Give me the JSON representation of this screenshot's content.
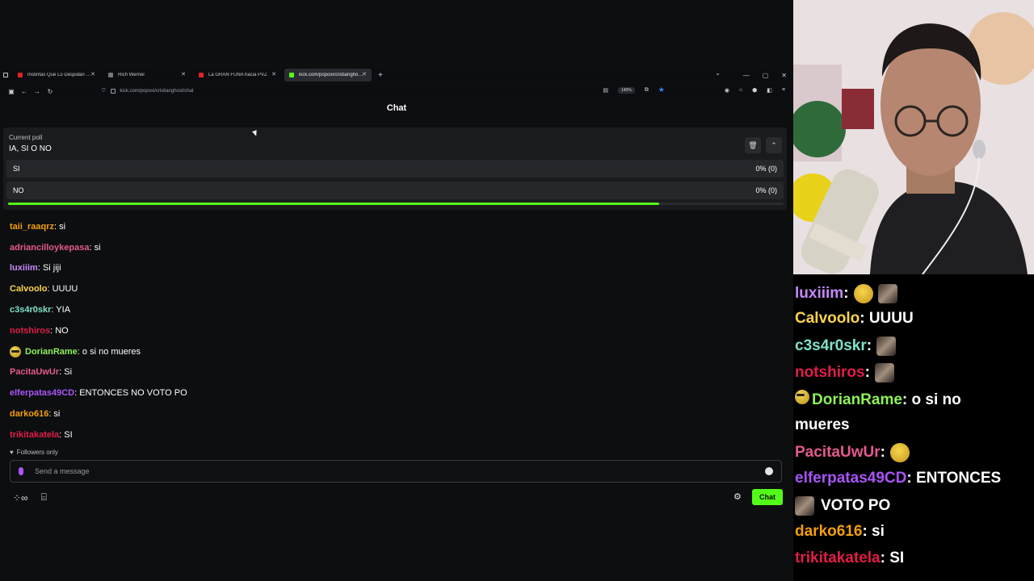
{
  "browser": {
    "tabs": [
      {
        "label": "Instintas Que Lo Despidan - Yo",
        "favicon_color": "#e02424",
        "active": false
      },
      {
        "label": "Rich Werner",
        "favicon_color": "#777777",
        "active": false
      },
      {
        "label": "La GRAN FUNA hacia PVZ",
        "favicon_color": "#e02424",
        "active": false
      },
      {
        "label": "kick.com/popoxi/cristianghost/chat",
        "favicon_color": "#53fc18",
        "active": true
      }
    ],
    "url": "kick.com/popoxi/cristianghost/chat",
    "zoom": "140%"
  },
  "page": {
    "title": "Chat"
  },
  "poll": {
    "caption": "Current poll",
    "question": "IA, SI O NO",
    "options": [
      {
        "label": "SI",
        "result": "0% (0)"
      },
      {
        "label": "NO",
        "result": "0% (0)"
      }
    ],
    "time_remaining_fraction": 0.84
  },
  "chat": {
    "messages": [
      {
        "user": "taii_raaqrz",
        "color": "#f59e0b",
        "text": ": si",
        "emote": false
      },
      {
        "user": "adriancilloykepasa",
        "color": "#e45a8c",
        "text": ": si",
        "emote": false
      },
      {
        "user": "luxiiim",
        "color": "#c58af9",
        "text": ": Si jiji",
        "emote": false
      },
      {
        "user": "Calvoolo",
        "color": "#fcd34d",
        "text": ": UUUU",
        "emote": false
      },
      {
        "user": "c3s4r0skr",
        "color": "#7ee2c8",
        "text": ": YIA",
        "emote": false
      },
      {
        "user": "notshiros",
        "color": "#e11d48",
        "text": ": NO",
        "emote": false
      },
      {
        "user": "DorianRame",
        "color": "#8ef25a",
        "text": ": o si no mueres",
        "emote": true
      },
      {
        "user": "PacitaUwUr",
        "color": "#e45a8c",
        "text": ": Si",
        "emote": false
      },
      {
        "user": "elferpatas49CD",
        "color": "#a855f7",
        "text": ": ENTONCES NO VOTO PO",
        "emote": false
      },
      {
        "user": "darko616",
        "color": "#f59e0b",
        "text": ": si",
        "emote": false
      },
      {
        "user": "trikitakatela",
        "color": "#e11d48",
        "text": ": SI",
        "emote": false
      }
    ],
    "followers_label": "Followers only",
    "input_placeholder": "Send a message",
    "send_label": "Chat"
  },
  "overlay": {
    "lines": [
      {
        "user": "luxiiim",
        "color": "#c58af9",
        "text": ":",
        "emotes": [
          "thumb",
          "photo"
        ]
      },
      {
        "user": "Calvoolo",
        "color": "#fcd34d",
        "text": ": UUUU",
        "emotes": []
      },
      {
        "user": "c3s4r0skr",
        "color": "#7ee2c8",
        "text": ":",
        "emotes": [
          "photo"
        ]
      },
      {
        "user": "notshiros",
        "color": "#e11d48",
        "text": ":",
        "emotes": [
          "photo"
        ]
      },
      {
        "user": "DorianRame",
        "color": "#8ef25a",
        "text": ": o si no",
        "emotes": [],
        "badge": true
      },
      {
        "user": "",
        "color": "#ffffff",
        "text": "mueres",
        "emotes": []
      },
      {
        "user": "PacitaUwUr",
        "color": "#e45a8c",
        "text": ":",
        "emotes": [
          "thumb"
        ]
      },
      {
        "user": "elferpatas49CD",
        "color": "#a855f7",
        "text": ": ENTONCES",
        "emotes": []
      },
      {
        "user": "",
        "color": "#ffffff",
        "text": "VOTO PO",
        "emotes": [],
        "lead_photo": true
      },
      {
        "user": "darko616",
        "color": "#f59e0b",
        "text": ": si",
        "emotes": []
      },
      {
        "user": "trikitakatela",
        "color": "#e11d48",
        "text": ": SI",
        "emotes": []
      }
    ]
  }
}
